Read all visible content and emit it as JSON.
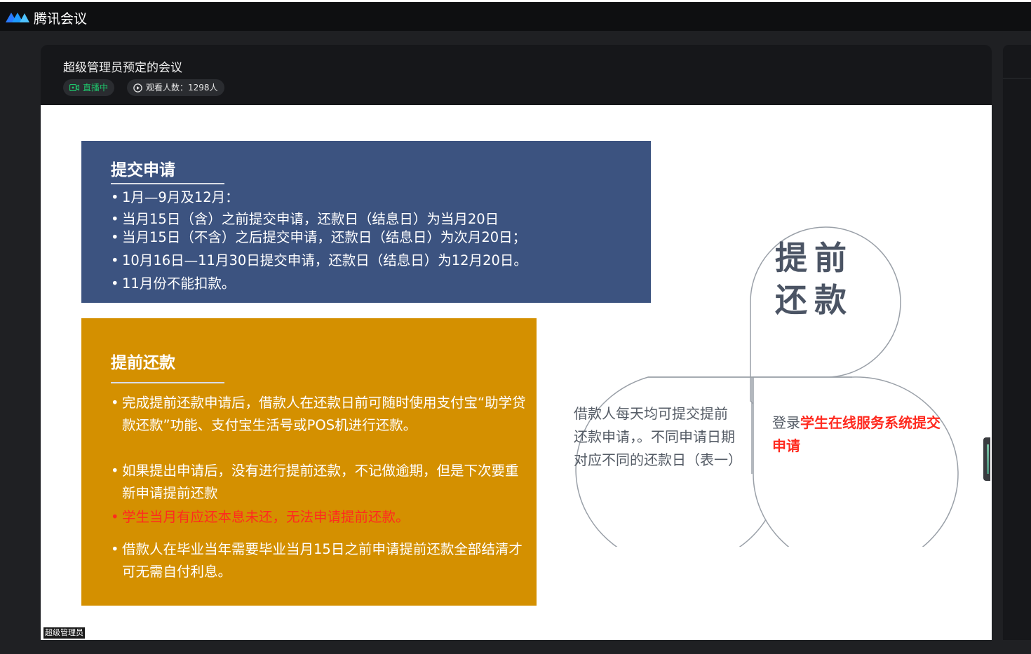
{
  "app": {
    "name": "腾讯会议"
  },
  "meeting": {
    "title": "超级管理员预定的会议",
    "live_label": "直播中",
    "viewers_label": "观看人数：1298人"
  },
  "slide": {
    "submit_box": {
      "title": "提交申请",
      "bullets": [
        "1月—9月及12月：",
        "当月15日（含）之前提交申请，还款日（结息日）为当月20日",
        "当月15日（不含）之后提交申请，还款日（结息日）为次月20日；",
        "10月16日—11月30日提交申请，还款日（结息日）为12月20日。",
        "11月份不能扣款。"
      ]
    },
    "prepay_box": {
      "title": "提前还款",
      "bullets": [
        "完成提前还款申请后，借款人在还款日前可随时使用支付宝“助学贷款还款”功能、支付宝生活号或POS机进行还款。",
        "如果提出申请后，没有进行提前还款，不记做逾期，但是下次要重新申请提前还款",
        "学生当月有应还本息未还，无法申请提前还款。",
        "借款人在毕业当年需要毕业当月15日之前申请提前还款全部结清才可无需自付利息。"
      ]
    },
    "circles": {
      "title": "提前还款",
      "left_text": "借款人每天均可提交提前还款申请，。不同申请日期对应不同的还款日（表一）",
      "right_prefix": "登录",
      "right_highlight": "学生在线服务系统提交申请"
    },
    "name_tag": "超级管理员"
  },
  "colors": {
    "blue_box": "#3c5380",
    "orange_box": "#d49000",
    "red_text": "#ff2a1f",
    "live_green": "#1fc46b"
  }
}
